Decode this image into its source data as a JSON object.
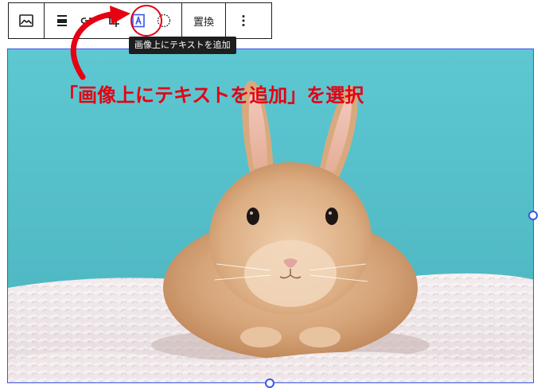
{
  "toolbar": {
    "buttons": [
      {
        "name": "image-block-icon",
        "label": "画像"
      },
      {
        "name": "align-icon",
        "label": "配置"
      },
      {
        "name": "link-icon",
        "label": "リンク"
      },
      {
        "name": "crop-icon",
        "label": "切り抜き"
      },
      {
        "name": "text-overlay-icon",
        "label": "画像上にテキストを追加"
      },
      {
        "name": "duotone-icon",
        "label": "デュオトーン"
      }
    ],
    "replace_label": "置換",
    "more_options": "⋮"
  },
  "tooltip": {
    "text": "画像上にテキストを追加"
  },
  "annotation": {
    "text": "「画像上にテキストを追加」を選択",
    "color": "#e60012"
  },
  "colors": {
    "selection_outline": "#3858e9",
    "toolbar_border": "#1e1e1e",
    "tooltip_bg": "#1e1e1e",
    "accent_icon": "#3858e9",
    "background_wall": "#5ec5cf",
    "rug": "#f0e9eb",
    "rabbit_fur": "#d6a479"
  },
  "image": {
    "subject": "bunny-photo"
  }
}
